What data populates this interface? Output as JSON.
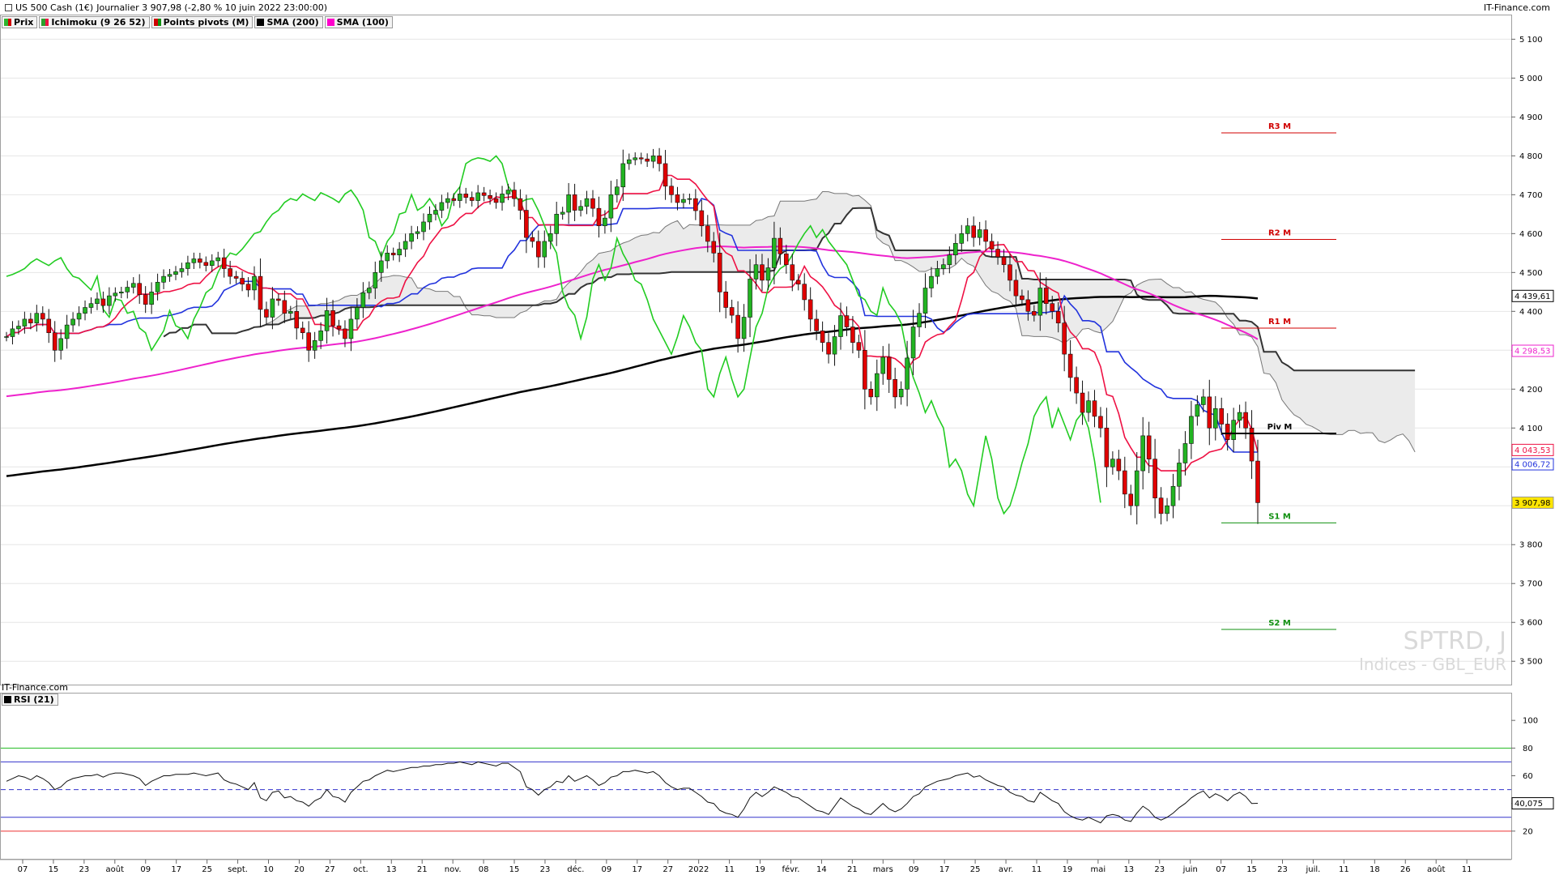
{
  "header": {
    "instrument": "US 500 Cash (1€)",
    "info": "Journalier 3 907,98 (-2,80 % 10 juin 2022 23:00:00)",
    "brand_top": "IT-Finance.com",
    "brand_mid": "IT-Finance.com",
    "watermark_symbol": "SPTRD, J",
    "watermark_market": "Indices - GBL_EUR",
    "settings_icon": "square-icon"
  },
  "legend": [
    {
      "label": "Prix",
      "color": "#2db52d",
      "icon": "candle-icon"
    },
    {
      "label": "Ichimoku (9 26 52)",
      "color": "#2ca02c",
      "icon": "ichimoku-icon"
    },
    {
      "label": "Points pivots (M)",
      "color": "#d00000",
      "icon": "pivot-icon"
    },
    {
      "label": "SMA (200)",
      "color": "#000000",
      "icon": "sma-icon"
    },
    {
      "label": "SMA (100)",
      "color": "#ff00cc",
      "icon": "sma-icon"
    }
  ],
  "rsi_legend": {
    "label": "RSI (21)",
    "color": "#000000"
  },
  "colors": {
    "up": "#22b422",
    "down": "#e00000",
    "tenkan": "#ee1144",
    "kijun": "#2233dd",
    "chikou": "#22cc22",
    "sma200": "#000000",
    "sma100": "#ee22cc",
    "cloud": "#ebebeb",
    "grid": "#e6e6e6"
  },
  "chart_data": [
    {
      "type": "candlestick",
      "title": "US 500 Cash (1€)",
      "ylim": [
        3440,
        5130
      ],
      "y_ticks": [
        5100,
        5000,
        4900,
        4800,
        4700,
        4600,
        4500,
        4400,
        4300,
        4200,
        4100,
        4000,
        3900,
        3800,
        3700,
        3600,
        3500
      ],
      "y_tick_labels": [
        "5 100",
        "5 000",
        "4 900",
        "4 800",
        "4 700",
        "4 600",
        "4 500",
        "4 400",
        "4 300",
        "4 200",
        "4 100",
        "4 000",
        "3 900",
        "3 800",
        "3 700",
        "3 600",
        "3 500"
      ],
      "x_tick_labels": [
        "07",
        "15",
        "23",
        "août",
        "09",
        "17",
        "25",
        "sept.",
        "10",
        "20",
        "27",
        "oct.",
        "13",
        "21",
        "nov.",
        "08",
        "15",
        "23",
        "déc.",
        "09",
        "17",
        "27",
        "2022",
        "11",
        "19",
        "févr.",
        "14",
        "21",
        "mars",
        "09",
        "17",
        "25",
        "avr.",
        "11",
        "19",
        "mai",
        "13",
        "23",
        "juin",
        "07",
        "15",
        "23",
        "juil.",
        "11",
        "18",
        "26",
        "août",
        "11"
      ],
      "closes": [
        4335,
        4355,
        4362,
        4380,
        4370,
        4395,
        4380,
        4345,
        4300,
        4330,
        4365,
        4380,
        4395,
        4410,
        4420,
        4432,
        4415,
        4440,
        4447,
        4450,
        4462,
        4472,
        4443,
        4418,
        4450,
        4475,
        4490,
        4495,
        4502,
        4510,
        4525,
        4535,
        4526,
        4518,
        4530,
        4538,
        4510,
        4490,
        4485,
        4470,
        4455,
        4490,
        4405,
        4385,
        4432,
        4428,
        4395,
        4400,
        4357,
        4345,
        4300,
        4325,
        4350,
        4402,
        4363,
        4355,
        4330,
        4380,
        4410,
        4448,
        4460,
        4500,
        4530,
        4550,
        4545,
        4560,
        4580,
        4600,
        4605,
        4630,
        4650,
        4660,
        4680,
        4690,
        4685,
        4702,
        4693,
        4685,
        4705,
        4698,
        4690,
        4680,
        4702,
        4712,
        4690,
        4660,
        4590,
        4580,
        4540,
        4580,
        4600,
        4650,
        4655,
        4700,
        4660,
        4670,
        4690,
        4665,
        4620,
        4640,
        4700,
        4720,
        4780,
        4790,
        4795,
        4792,
        4786,
        4800,
        4780,
        4722,
        4700,
        4680,
        4688,
        4690,
        4659,
        4620,
        4580,
        4550,
        4450,
        4410,
        4390,
        4330,
        4385,
        4483,
        4520,
        4480,
        4512,
        4588,
        4548,
        4520,
        4480,
        4470,
        4430,
        4380,
        4350,
        4320,
        4290,
        4335,
        4389,
        4360,
        4320,
        4300,
        4200,
        4180,
        4240,
        4282,
        4225,
        4180,
        4200,
        4280,
        4360,
        4395,
        4460,
        4490,
        4510,
        4520,
        4545,
        4575,
        4600,
        4620,
        4590,
        4610,
        4580,
        4560,
        4540,
        4520,
        4480,
        4440,
        4430,
        4400,
        4390,
        4460,
        4420,
        4400,
        4370,
        4290,
        4230,
        4190,
        4140,
        4170,
        4130,
        4100,
        4000,
        4020,
        3990,
        3930,
        3900,
        3990,
        4080,
        4020,
        3920,
        3880,
        3900,
        3950,
        4010,
        4060,
        4130,
        4160,
        4180,
        4100,
        4150,
        4110,
        4070,
        4120,
        4140,
        4100,
        4015,
        3907.98
      ],
      "last_price_label": "3 907,98",
      "tenkan_label": "4 043,53",
      "kijun_label": "4 006,72",
      "sma200_label": "4 439,61",
      "sma100_label": "4 298,53",
      "pivots": [
        {
          "label": "R3 M",
          "value": 4859,
          "color": "#d00000"
        },
        {
          "label": "R2 M",
          "value": 4585,
          "color": "#d00000"
        },
        {
          "label": "R1 M",
          "value": 4357,
          "color": "#d00000"
        },
        {
          "label": "Piv M",
          "value": 4086,
          "color": "#000000"
        },
        {
          "label": "S1 M",
          "value": 3856,
          "color": "#109010"
        },
        {
          "label": "S2 M",
          "value": 3582,
          "color": "#109010"
        }
      ]
    },
    {
      "type": "line",
      "title": "RSI (21)",
      "ylim": [
        0,
        120
      ],
      "y_ticks": [
        100,
        80,
        60,
        40,
        20
      ],
      "y_tick_labels": [
        "100",
        "80",
        "60",
        "40",
        "20"
      ],
      "levels": [
        {
          "value": 80,
          "color": "#22bb22"
        },
        {
          "value": 70,
          "color": "#3333cc"
        },
        {
          "value": 50,
          "color": "#3333cc",
          "dashed": true
        },
        {
          "value": 30,
          "color": "#3333cc"
        },
        {
          "value": 20,
          "color": "#ee3333"
        }
      ],
      "last_value_label": "40,075",
      "values": [
        56,
        58,
        60,
        59,
        57,
        60,
        58,
        55,
        50,
        52,
        56,
        58,
        59,
        60,
        60,
        61,
        59,
        61,
        62,
        62,
        61,
        60,
        58,
        53,
        56,
        58,
        60,
        60,
        61,
        61,
        61,
        62,
        61,
        60,
        61,
        62,
        57,
        55,
        54,
        52,
        50,
        55,
        44,
        42,
        48,
        49,
        44,
        45,
        42,
        41,
        38,
        42,
        44,
        50,
        45,
        44,
        41,
        48,
        52,
        56,
        57,
        60,
        62,
        64,
        63,
        64,
        65,
        66,
        66,
        67,
        67,
        68,
        68,
        69,
        69,
        70,
        69,
        68,
        70,
        69,
        68,
        67,
        69,
        69,
        66,
        63,
        52,
        50,
        46,
        50,
        52,
        56,
        55,
        60,
        56,
        58,
        60,
        57,
        53,
        55,
        59,
        60,
        63,
        63,
        64,
        63,
        62,
        63,
        60,
        55,
        52,
        50,
        51,
        51,
        48,
        45,
        41,
        40,
        35,
        33,
        32,
        30,
        36,
        44,
        48,
        45,
        48,
        52,
        50,
        48,
        45,
        44,
        41,
        38,
        35,
        34,
        32,
        38,
        44,
        41,
        38,
        36,
        33,
        32,
        36,
        40,
        36,
        34,
        36,
        40,
        45,
        47,
        52,
        54,
        56,
        57,
        58,
        60,
        61,
        62,
        59,
        60,
        57,
        55,
        53,
        52,
        48,
        46,
        45,
        42,
        41,
        48,
        45,
        42,
        40,
        34,
        31,
        29,
        28,
        30,
        28,
        26,
        31,
        32,
        31,
        28,
        27,
        33,
        38,
        35,
        30,
        28,
        30,
        33,
        37,
        40,
        44,
        47,
        49,
        44,
        47,
        45,
        42,
        46,
        48,
        45,
        40,
        40.075
      ]
    }
  ]
}
